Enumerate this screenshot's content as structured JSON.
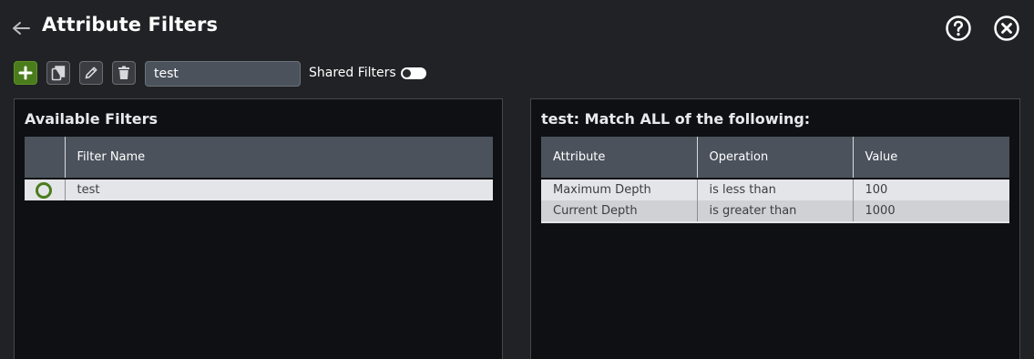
{
  "header": {
    "title": "Attribute Filters",
    "back_icon": "arrow-left-icon",
    "help_icon": "question-circle-icon",
    "close_icon": "close-circle-icon"
  },
  "toolbar": {
    "add_icon": "plus-icon",
    "copy_icon": "copy-icon",
    "edit_icon": "pencil-icon",
    "delete_icon": "trash-icon",
    "filter_name_value": "test",
    "shared_filters_label": "Shared Filters",
    "shared_filters_enabled": false,
    "accent_color": "#4a7c1c"
  },
  "available_filters": {
    "title": "Available Filters",
    "columns": [
      "",
      "Filter Name"
    ],
    "rows": [
      {
        "selected": true,
        "name": "test"
      }
    ]
  },
  "filter_detail": {
    "title": "test: Match ALL of the following:",
    "columns": [
      "Attribute",
      "Operation",
      "Value"
    ],
    "rows": [
      {
        "attribute": "Maximum Depth",
        "operation": "is less than",
        "value": "100"
      },
      {
        "attribute": "Current Depth",
        "operation": "is greater than",
        "value": "1000"
      }
    ]
  }
}
